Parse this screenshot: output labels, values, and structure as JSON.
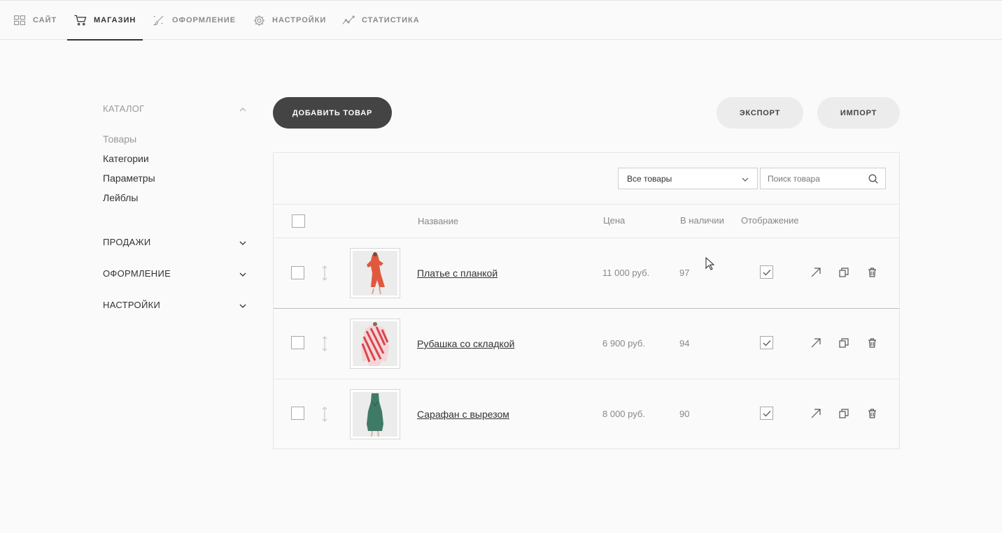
{
  "nav": {
    "items": [
      {
        "label": "САЙТ",
        "icon": "grid-icon",
        "active": false
      },
      {
        "label": "МАГАЗИН",
        "icon": "cart-icon",
        "active": true
      },
      {
        "label": "ОФОРМЛЕНИЕ",
        "icon": "brush-icon",
        "active": false
      },
      {
        "label": "НАСТРОЙКИ",
        "icon": "gear-icon",
        "active": false
      },
      {
        "label": "СТАТИСТИКА",
        "icon": "chart-icon",
        "active": false
      }
    ]
  },
  "sidebar": {
    "catalog": {
      "title": "КАТАЛОГ",
      "items": [
        "Товары",
        "Категории",
        "Параметры",
        "Лейблы"
      ]
    },
    "sections": [
      "ПРОДАЖИ",
      "ОФОРМЛЕНИЕ",
      "НАСТРОЙКИ"
    ]
  },
  "toolbar": {
    "add_label": "ДОБАВИТЬ ТОВАР",
    "export_label": "ЭКСПОРТ",
    "import_label": "ИМПОРТ"
  },
  "filter": {
    "selected": "Все товары",
    "search_placeholder": "Поиск товара"
  },
  "table": {
    "headers": {
      "name": "Название",
      "price": "Цена",
      "stock": "В наличии",
      "visibility": "Отображение"
    },
    "rows": [
      {
        "name": "Платье с планкой",
        "price": "11 000 руб.",
        "stock": "97",
        "visible": true
      },
      {
        "name": "Рубашка со складкой",
        "price": "6 900 руб.",
        "stock": "94",
        "visible": true
      },
      {
        "name": "Сарафан с вырезом",
        "price": "8 000 руб.",
        "stock": "90",
        "visible": true
      }
    ]
  },
  "colors": {
    "dark_button": "#444444",
    "light_button": "#ececec",
    "dress_red": "#e0583e",
    "shirt_red": "#d8454d",
    "dress_green": "#3f7a66"
  }
}
